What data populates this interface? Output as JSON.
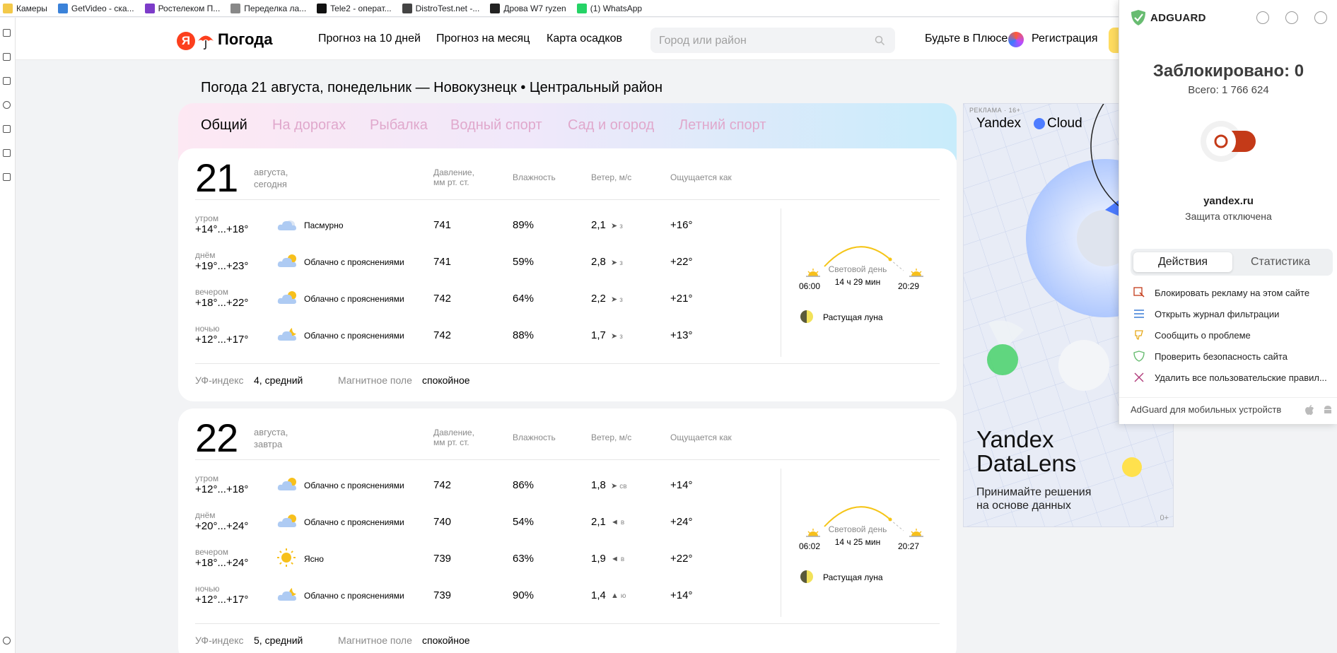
{
  "bookmarks": [
    {
      "label": "Камеры",
      "color": "#f3c94a"
    },
    {
      "label": "GetVideo - ска...",
      "color": "#3b82d9"
    },
    {
      "label": "Ростелеком П...",
      "color": "#7d3cc9"
    },
    {
      "label": "Переделка ла...",
      "color": "#888888"
    },
    {
      "label": "Tele2 - операт...",
      "color": "#111111"
    },
    {
      "label": "DistroTest.net -...",
      "color": "#444444"
    },
    {
      "label": "Дрова W7 ryzen",
      "color": "#222222"
    },
    {
      "label": "(1) WhatsApp",
      "color": "#25d366"
    }
  ],
  "header": {
    "logo_letter": "Я",
    "logo_text": "Погода",
    "nav": [
      "Прогноз на 10 дней",
      "Прогноз на месяц",
      "Карта осадков"
    ],
    "search_placeholder": "Город или район",
    "plus": "Будьте в Плюсе",
    "register": "Регистрация"
  },
  "page_title": "Погода 21 августа, понедельник — Новокузнецк • Центральный район",
  "tabs": [
    "Общий",
    "На дорогах",
    "Рыбалка",
    "Водный спорт",
    "Сад и огород",
    "Летний спорт"
  ],
  "columns": {
    "pressure": "Давление,\nмм рт. ст.",
    "humidity": "Влажность",
    "wind": "Ветер, м/с",
    "feels": "Ощущается как"
  },
  "days": [
    {
      "num": "21",
      "label": "августа,\nсегодня",
      "parts": [
        {
          "period": "утром",
          "temp": "+14°...+18°",
          "icon": "cloudy",
          "cond": "Пасмурно",
          "pressure": "741",
          "humidity": "89%",
          "wind": "2,1",
          "arrow": "➤",
          "dir": "з",
          "feels": "+16°"
        },
        {
          "period": "днём",
          "temp": "+19°...+23°",
          "icon": "partly-cloudy",
          "cond": "Облачно с прояснениями",
          "pressure": "741",
          "humidity": "59%",
          "wind": "2,8",
          "arrow": "➤",
          "dir": "з",
          "feels": "+22°"
        },
        {
          "period": "вечером",
          "temp": "+18°...+22°",
          "icon": "partly-cloudy",
          "cond": "Облачно с прояснениями",
          "pressure": "742",
          "humidity": "64%",
          "wind": "2,2",
          "arrow": "➤",
          "dir": "з",
          "feels": "+21°"
        },
        {
          "period": "ночью",
          "temp": "+12°...+17°",
          "icon": "partly-cloudy-night",
          "cond": "Облачно с прояснениями",
          "pressure": "742",
          "humidity": "88%",
          "wind": "1,7",
          "arrow": "➤",
          "dir": "з",
          "feels": "+13°"
        }
      ],
      "sunrise": "06:00",
      "sunset": "20:29",
      "daylight_label": "Световой день",
      "daylight": "14 ч 29 мин",
      "moon": "Растущая луна",
      "uv_label": "УФ-индекс",
      "uv": "4, средний",
      "mag_label": "Магнитное поле",
      "mag": "спокойное"
    },
    {
      "num": "22",
      "label": "августа,\nзавтра",
      "parts": [
        {
          "period": "утром",
          "temp": "+12°...+18°",
          "icon": "partly-cloudy",
          "cond": "Облачно с прояснениями",
          "pressure": "742",
          "humidity": "86%",
          "wind": "1,8",
          "arrow": "➤",
          "dir": "св",
          "feels": "+14°"
        },
        {
          "period": "днём",
          "temp": "+20°...+24°",
          "icon": "partly-cloudy",
          "cond": "Облачно с прояснениями",
          "pressure": "740",
          "humidity": "54%",
          "wind": "2,1",
          "arrow": "◄",
          "dir": "в",
          "feels": "+24°"
        },
        {
          "period": "вечером",
          "temp": "+18°...+24°",
          "icon": "clear",
          "cond": "Ясно",
          "pressure": "739",
          "humidity": "63%",
          "wind": "1,9",
          "arrow": "◄",
          "dir": "в",
          "feels": "+22°"
        },
        {
          "period": "ночью",
          "temp": "+12°...+17°",
          "icon": "partly-cloudy-night",
          "cond": "Облачно с прояснениями",
          "pressure": "739",
          "humidity": "90%",
          "wind": "1,4",
          "arrow": "▲",
          "dir": "ю",
          "feels": "+14°"
        }
      ],
      "sunrise": "06:02",
      "sunset": "20:27",
      "daylight_label": "Световой день",
      "daylight": "14 ч 25 мин",
      "moon": "Растущая луна",
      "uv_label": "УФ-индекс",
      "uv": "5, средний",
      "mag_label": "Магнитное поле",
      "mag": "спокойное"
    }
  ],
  "ad": {
    "label": "РЕКЛАМА · 16+",
    "brand_a": "Yandex",
    "brand_b": "Cloud",
    "headline": "Yandex\nDataLens",
    "sub": "Принимайте решения\nна основе данных",
    "age": "0+"
  },
  "adguard": {
    "name": "ADGUARD",
    "blocked": "Заблокировано: 0",
    "total": "Всего: 1 766 624",
    "site": "yandex.ru",
    "protection": "Защита отключена",
    "tabs": [
      "Действия",
      "Статистика"
    ],
    "actions": [
      "Блокировать рекламу на этом сайте",
      "Открыть журнал фильтрации",
      "Сообщить о проблеме",
      "Проверить безопасность сайта",
      "Удалить все пользовательские правил..."
    ],
    "footer": "AdGuard для мобильных устройств",
    "accent": "#68bc71"
  }
}
